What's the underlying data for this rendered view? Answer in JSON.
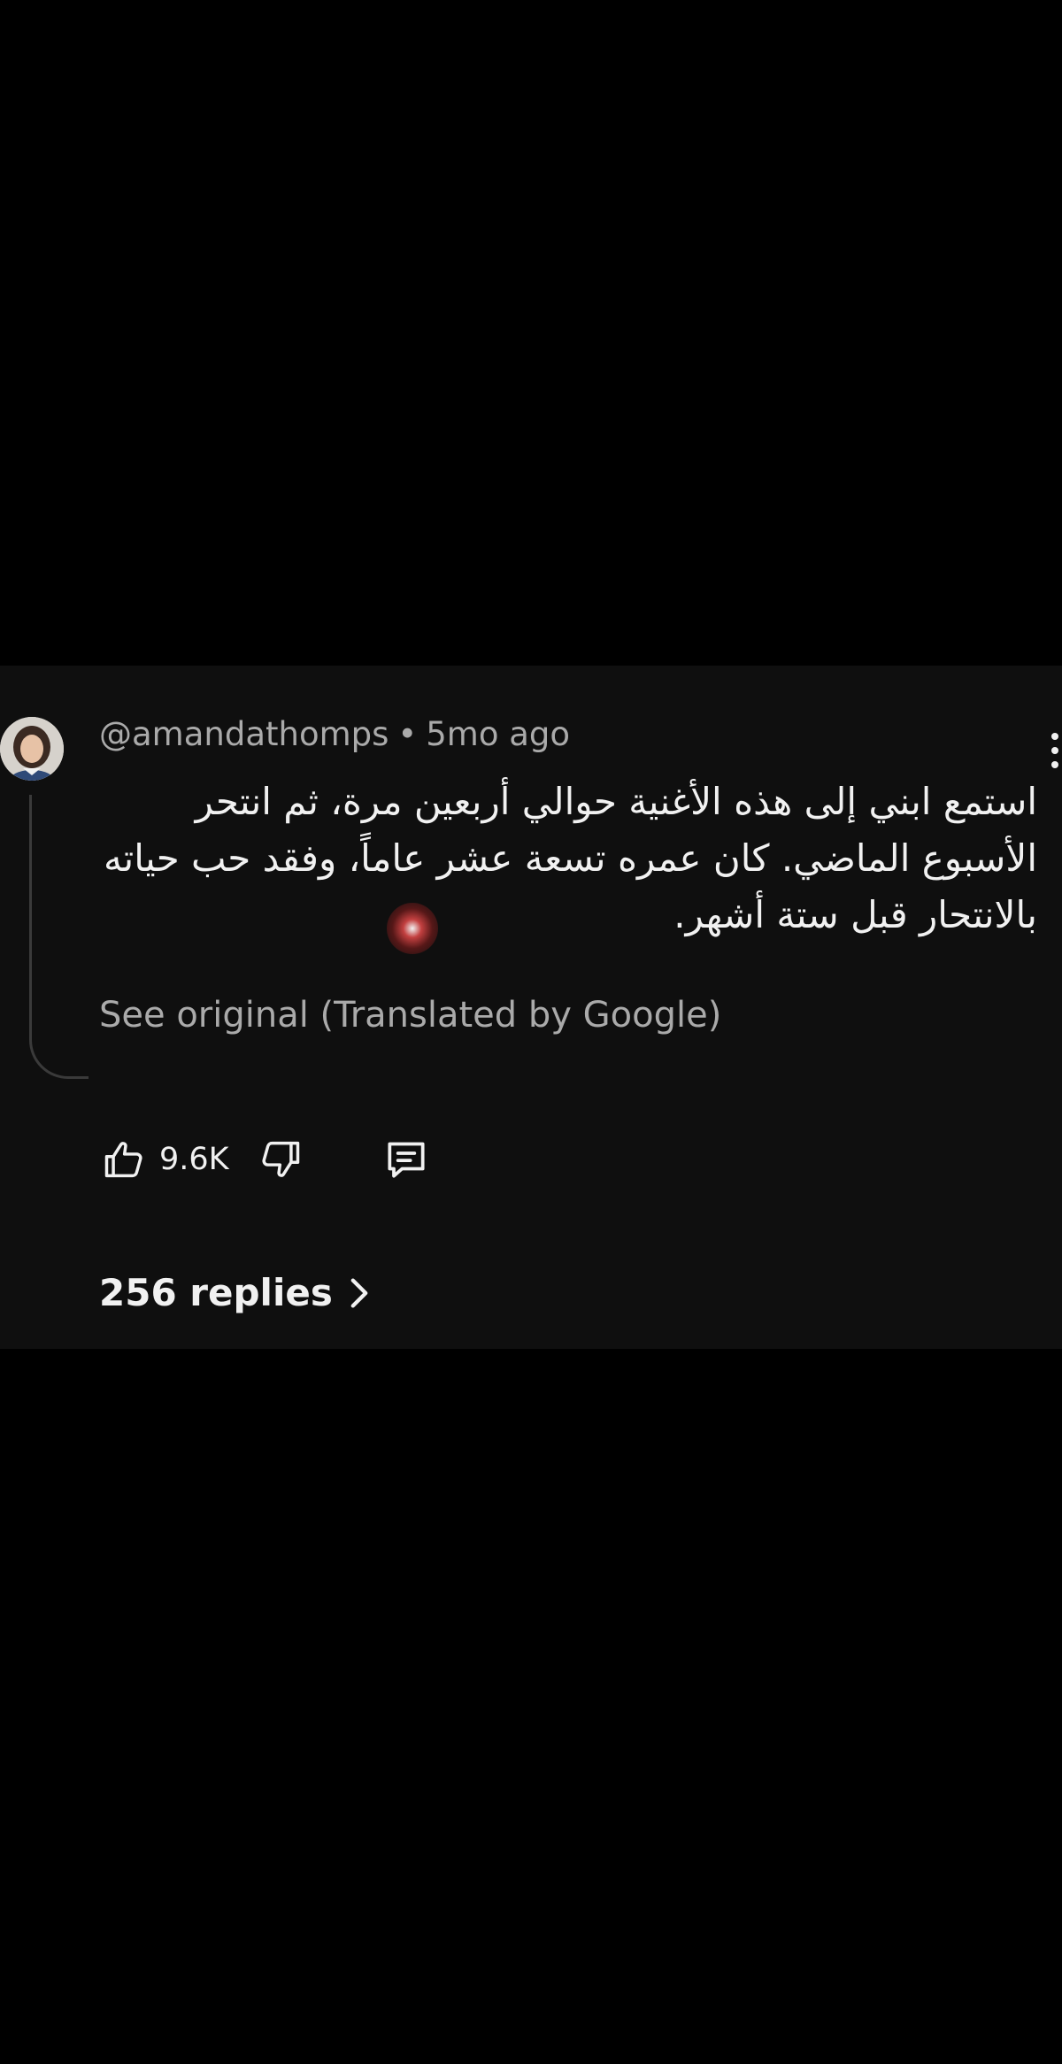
{
  "comment": {
    "username": "@amandathomps",
    "separator": "•",
    "time": "5mo ago",
    "text": "استمع ابني إلى هذه الأغنية حوالي أربعين مرة، ثم انتحر\nالأسبوع الماضي. كان عمره تسعة عشر عاماً، وفقد حب حياته\nبالانتحار قبل ستة أشهر.",
    "see_original": "See original (Translated by Google)",
    "like_count": "9.6K",
    "replies_label": "256 replies",
    "icons": {
      "avatar": "avatar-photo",
      "more": "kebab-menu-icon",
      "like": "thumbs-up-icon",
      "dislike": "thumbs-down-icon",
      "reply": "comment-reply-icon",
      "chevron": "chevron-right-icon"
    }
  },
  "colors": {
    "background": "#000000",
    "card": "#0f0f0f",
    "text_primary": "#f1f1f1",
    "text_secondary": "#aaaaaa",
    "thread_line": "#3a3a3a"
  }
}
